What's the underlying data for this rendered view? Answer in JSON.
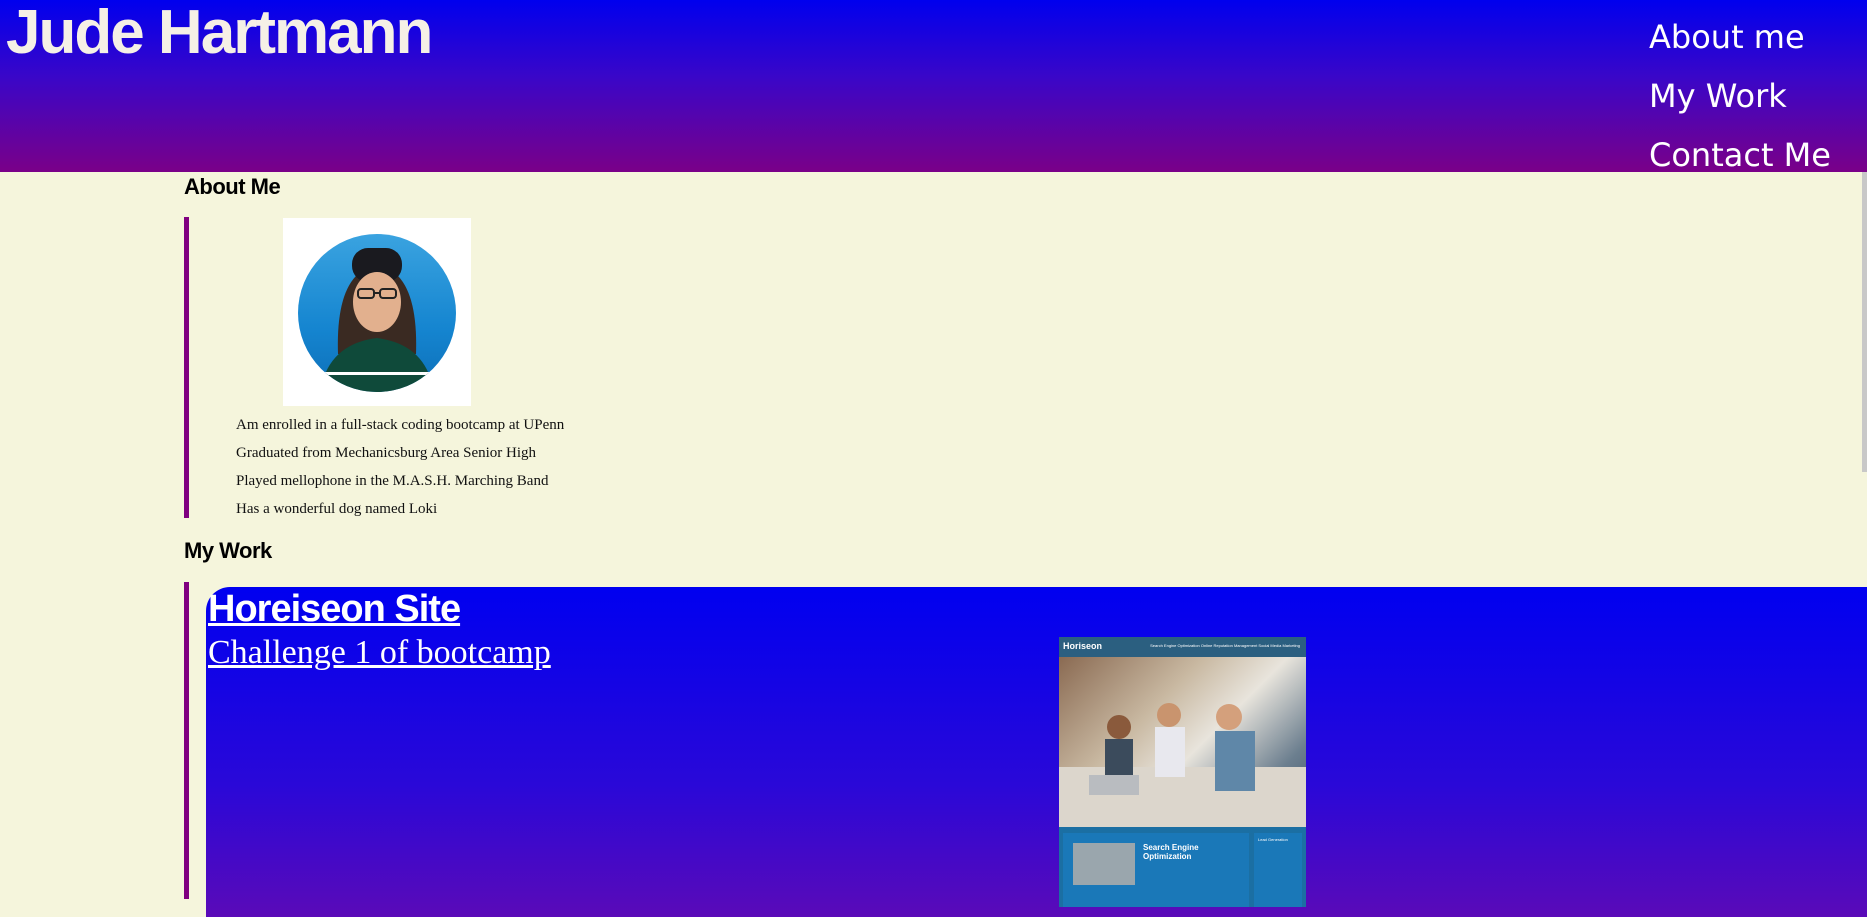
{
  "header": {
    "site_title": "Jude Hartmann",
    "nav": [
      "About me",
      "My Work",
      "Contact Me"
    ]
  },
  "about": {
    "heading": "About Me",
    "portrait_alt": "Profile photo of Jude Hartmann",
    "facts": [
      "Am enrolled in a full-stack coding bootcamp at UPenn",
      "Graduated from Mechanicsburg Area Senior High",
      "Played mellophone in the M.A.S.H. Marching Band",
      "Has a wonderful dog named Loki"
    ]
  },
  "work": {
    "heading": "My Work",
    "projects": [
      {
        "title": "Horeiseon Site",
        "subtitle": "Challenge 1 of bootcamp",
        "screenshot": {
          "logo": "Horiseon",
          "links": "Search Engine Optimization   Online Reputation Management   Social Media Marketing",
          "section_title": "Search Engine Optimization",
          "side_title": "Lead Generation"
        }
      }
    ]
  },
  "colors": {
    "header_top": "#0000ee",
    "header_bottom": "#7a0088",
    "page_bg": "#f5f5dc",
    "accent_border": "#800080"
  }
}
